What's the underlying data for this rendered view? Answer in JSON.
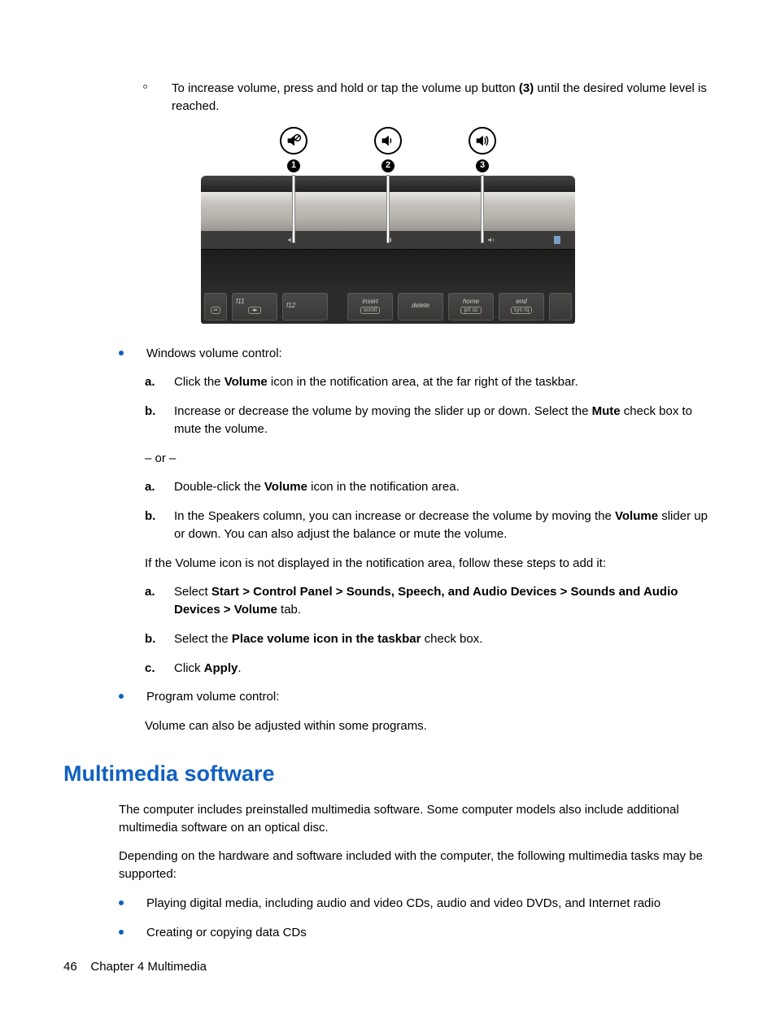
{
  "intro": {
    "line_a": "To increase volume, press and hold or tap the volume up button ",
    "bold_ref": "(3)",
    "line_b": " until the desired volume level is reached."
  },
  "figure": {
    "callouts": [
      "1",
      "2",
      "3"
    ],
    "icons": [
      "volume-mute-icon",
      "volume-down-icon",
      "volume-up-icon"
    ],
    "keys": [
      {
        "label": "f11",
        "sub": "◂▸"
      },
      {
        "label": "f12",
        "sub": ""
      },
      {
        "label": "insert",
        "sub": "scroll"
      },
      {
        "label": "delete",
        "sub": ""
      },
      {
        "label": "home",
        "sub": "prt sc"
      },
      {
        "label": "end",
        "sub": "sys rq"
      }
    ]
  },
  "win": {
    "title": "Windows volume control:",
    "a1_pre": "Click the ",
    "a1_b": "Volume",
    "a1_post": " icon in the notification area, at the far right of the taskbar.",
    "b1_pre": "Increase or decrease the volume by moving the slider up or down. Select the ",
    "b1_b": "Mute",
    "b1_post": " check box to mute the volume.",
    "or": "– or –",
    "a2_pre": "Double-click the ",
    "a2_b": "Volume",
    "a2_post": " icon in the notification area.",
    "b2_pre": "In the Speakers column, you can increase or decrease the volume by moving the ",
    "b2_b": "Volume",
    "b2_post": " slider up or down. You can also adjust the balance or mute the volume.",
    "notice": "If the Volume icon is not displayed in the notification area, follow these steps to add it:",
    "c1_pre": "Select ",
    "c1_b": "Start > Control Panel > Sounds, Speech, and Audio Devices > Sounds and Audio Devices > Volume",
    "c1_post": " tab.",
    "c2_pre": "Select the ",
    "c2_b": "Place volume icon in the taskbar",
    "c2_post": " check box.",
    "c3_pre": "Click ",
    "c3_b": "Apply",
    "c3_post": "."
  },
  "prog": {
    "title": "Program volume control:",
    "text": "Volume can also be adjusted within some programs."
  },
  "heading": "Multimedia software",
  "mm": {
    "p1": "The computer includes preinstalled multimedia software. Some computer models also include additional multimedia software on an optical disc.",
    "p2": "Depending on the hardware and software included with the computer, the following multimedia tasks may be supported:",
    "b1": "Playing digital media, including audio and video CDs, audio and video DVDs, and Internet radio",
    "b2": "Creating or copying data CDs"
  },
  "footer": {
    "page": "46",
    "chapter": "Chapter 4   Multimedia"
  }
}
